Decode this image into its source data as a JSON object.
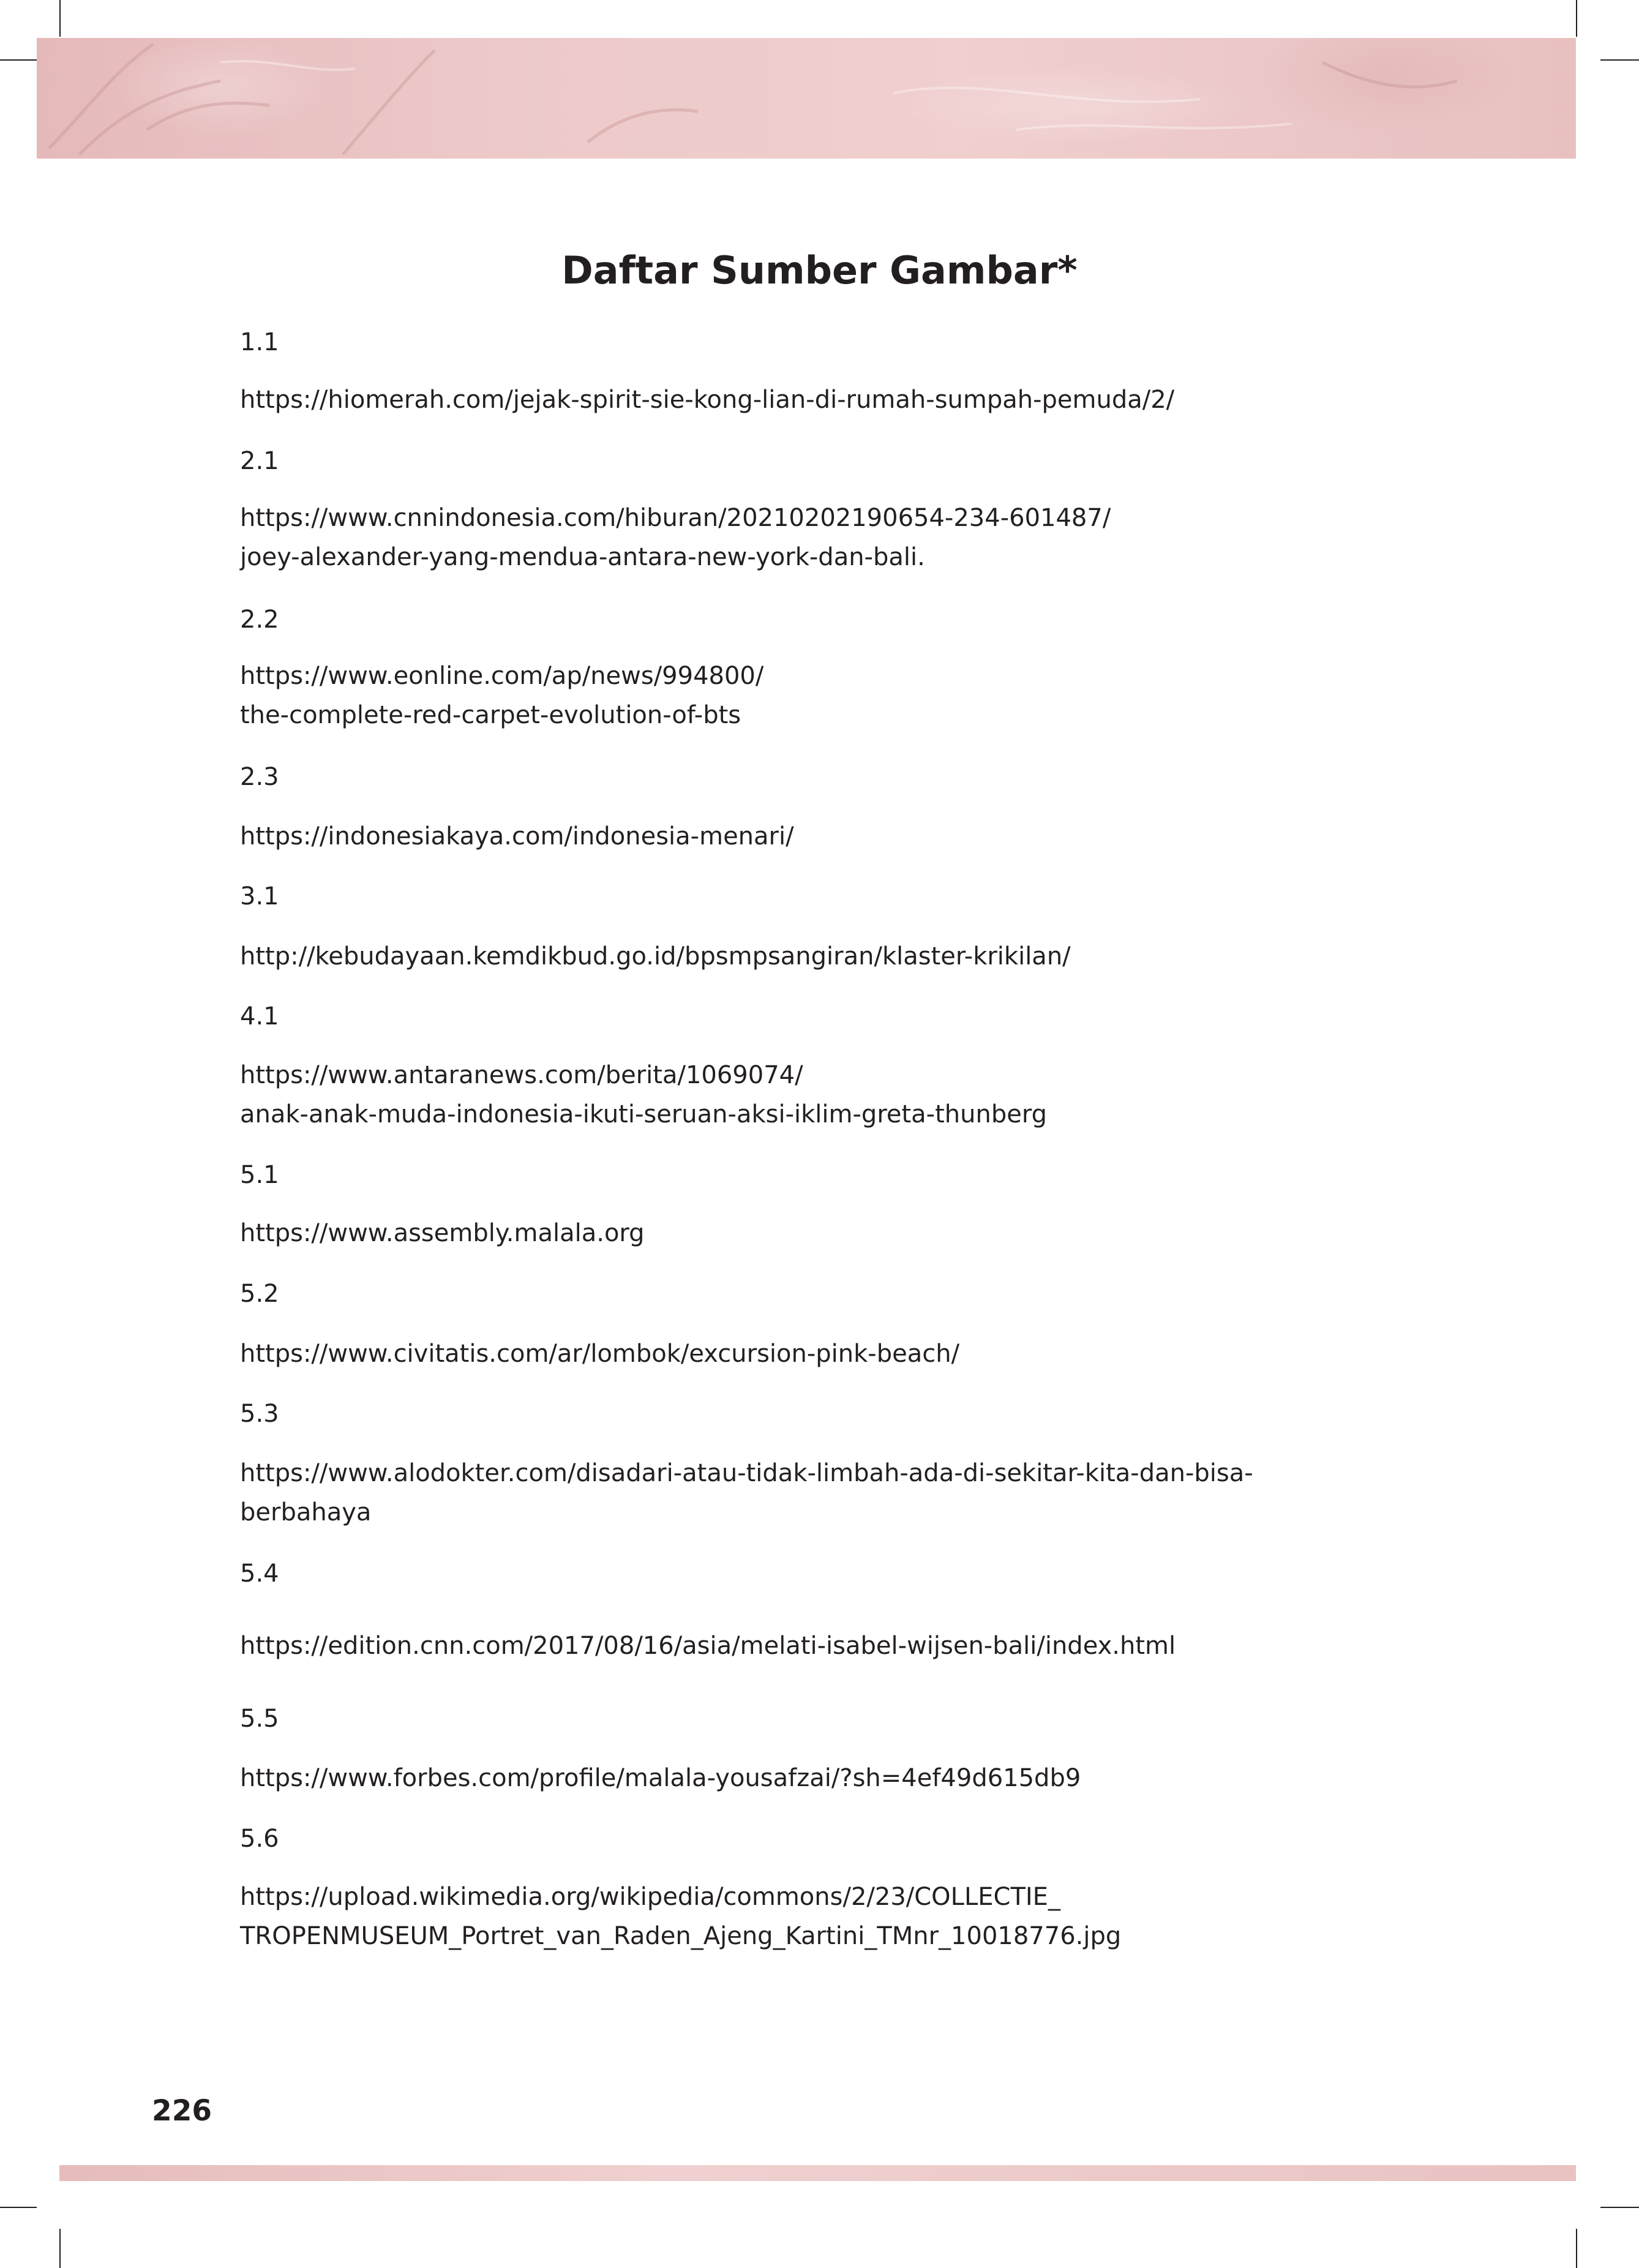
{
  "title": "Daftar Sumber Gambar*",
  "page_number": "226",
  "entries": [
    {
      "num": "1.1",
      "url": "https://hiomerah.com/jejak-spirit-sie-kong-lian-di-rumah-sumpah-pemuda/2/"
    },
    {
      "num": "2.1",
      "url": "https://www.cnnindonesia.com/hiburan/20210202190654-234-601487/\njoey-alexander-yang-mendua-antara-new-york-dan-bali."
    },
    {
      "num": "2.2",
      "url": "https://www.eonline.com/ap/news/994800/\nthe-complete-red-carpet-evolution-of-bts"
    },
    {
      "num": "2.3",
      "url": "https://indonesiakaya.com/indonesia-menari/"
    },
    {
      "num": "3.1",
      "url": "http://kebudayaan.kemdikbud.go.id/bpsmpsangiran/klaster-krikilan/"
    },
    {
      "num": "4.1",
      "url": "https://www.antaranews.com/berita/1069074/\nanak-anak-muda-indonesia-ikuti-seruan-aksi-iklim-greta-thunberg"
    },
    {
      "num": "5.1",
      "url": "https://www.assembly.malala.org"
    },
    {
      "num": "5.2",
      "url": "https://www.civitatis.com/ar/lombok/excursion-pink-beach/"
    },
    {
      "num": "5.3",
      "url": "https://www.alodokter.com/disadari-atau-tidak-limbah-ada-di-sekitar-kita-dan-bisa-\nberbahaya"
    },
    {
      "num": "5.4",
      "url": "https://edition.cnn.com/2017/08/16/asia/melati-isabel-wijsen-bali/index.html"
    },
    {
      "num": "5.5",
      "url": "https://www.forbes.com/profile/malala-yousafzai/?sh=4ef49d615db9"
    },
    {
      "num": "5.6",
      "url": "https://upload.wikimedia.org/wikipedia/commons/2/23/COLLECTIE_\nTROPENMUSEUM_Portret_van_Raden_Ajeng_Kartini_TMnr_10018776.jpg"
    }
  ]
}
